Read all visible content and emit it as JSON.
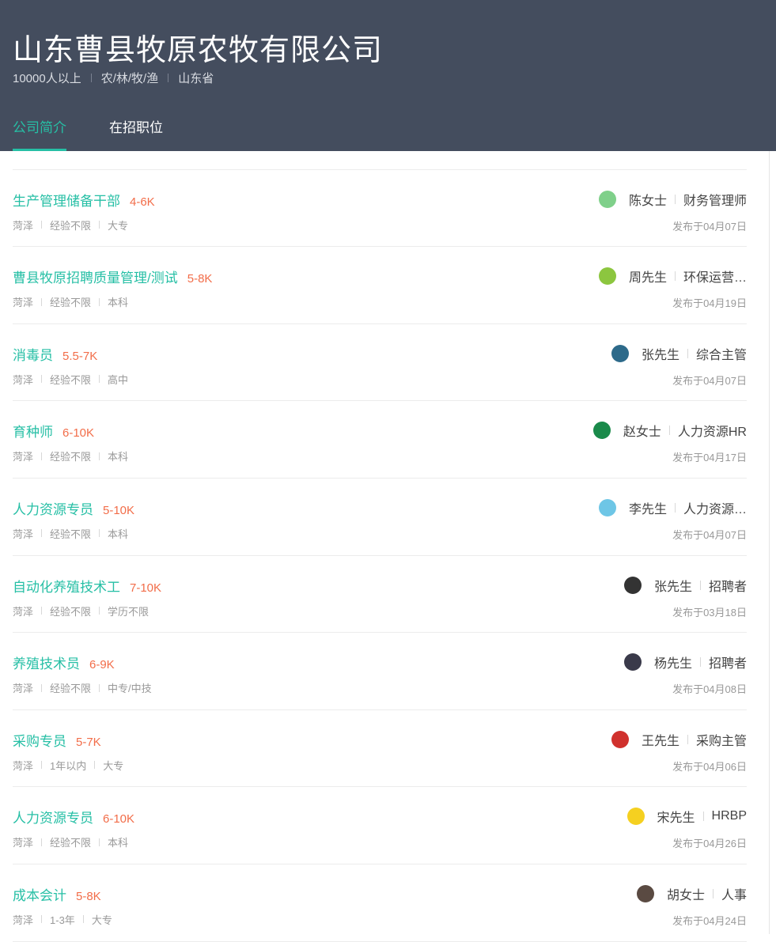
{
  "company": {
    "name": "山东曹县牧原农牧有限公司",
    "size": "10000人以上",
    "industry": "农/林/牧/渔",
    "location": "山东省"
  },
  "tabs": [
    {
      "label": "公司简介",
      "active": true
    },
    {
      "label": "在招职位",
      "active": false
    }
  ],
  "jobs": [
    {
      "title": "",
      "salary": "",
      "city": "",
      "experience": "",
      "education": "",
      "recruiter": "",
      "role": "",
      "date": ""
    },
    {
      "title": "生产管理储备干部",
      "salary": "4-6K",
      "city": "菏泽",
      "experience": "经验不限",
      "education": "大专",
      "recruiter": "陈女士",
      "role": "财务管理师",
      "date": "发布于04月07日",
      "avatar_color": "#7fd08a"
    },
    {
      "title": "曹县牧原招聘质量管理/测试",
      "salary": "5-8K",
      "city": "菏泽",
      "experience": "经验不限",
      "education": "本科",
      "recruiter": "周先生",
      "role": "环保运营…",
      "date": "发布于04月19日",
      "avatar_color": "#8cc63f"
    },
    {
      "title": "消毒员",
      "salary": "5.5-7K",
      "city": "菏泽",
      "experience": "经验不限",
      "education": "高中",
      "recruiter": "张先生",
      "role": "综合主管",
      "date": "发布于04月07日",
      "avatar_color": "#2d6a8a"
    },
    {
      "title": "育种师",
      "salary": "6-10K",
      "city": "菏泽",
      "experience": "经验不限",
      "education": "本科",
      "recruiter": "赵女士",
      "role": "人力资源HR",
      "date": "发布于04月17日",
      "avatar_color": "#1a8a4a"
    },
    {
      "title": "人力资源专员",
      "salary": "5-10K",
      "city": "菏泽",
      "experience": "经验不限",
      "education": "本科",
      "recruiter": "李先生",
      "role": "人力资源…",
      "date": "发布于04月07日",
      "avatar_color": "#6ec6e6"
    },
    {
      "title": "自动化养殖技术工",
      "salary": "7-10K",
      "city": "菏泽",
      "experience": "经验不限",
      "education": "学历不限",
      "recruiter": "张先生",
      "role": "招聘者",
      "date": "发布于03月18日",
      "avatar_color": "#333333"
    },
    {
      "title": "养殖技术员",
      "salary": "6-9K",
      "city": "菏泽",
      "experience": "经验不限",
      "education": "中专/中技",
      "recruiter": "杨先生",
      "role": "招聘者",
      "date": "发布于04月08日",
      "avatar_color": "#3a3a4a"
    },
    {
      "title": "采购专员",
      "salary": "5-7K",
      "city": "菏泽",
      "experience": "1年以内",
      "education": "大专",
      "recruiter": "王先生",
      "role": "采购主管",
      "date": "发布于04月06日",
      "avatar_color": "#d0312d"
    },
    {
      "title": "人力资源专员",
      "salary": "6-10K",
      "city": "菏泽",
      "experience": "经验不限",
      "education": "本科",
      "recruiter": "宋先生",
      "role": "HRBP",
      "date": "发布于04月26日",
      "avatar_color": "#f5d020"
    },
    {
      "title": "成本会计",
      "salary": "5-8K",
      "city": "菏泽",
      "experience": "1-3年",
      "education": "大专",
      "recruiter": "胡女士",
      "role": "人事",
      "date": "发布于04月24日",
      "avatar_color": "#5a4a42"
    }
  ]
}
